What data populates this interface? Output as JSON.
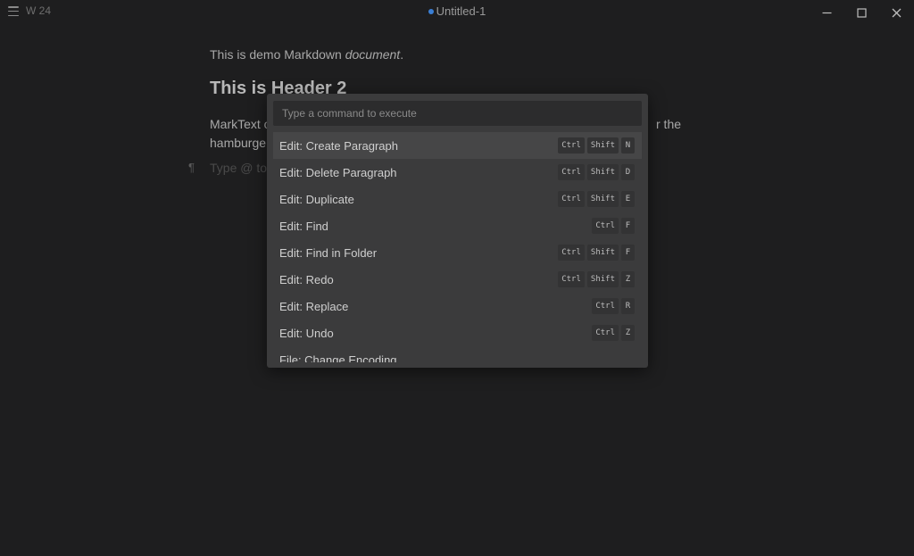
{
  "titlebar": {
    "word_count": "W 24",
    "title": "Untitled-1"
  },
  "document": {
    "p1_text": "This is demo Markdown ",
    "p1_em": "document",
    "p1_end": ".",
    "h2": "This is Header 2",
    "p2_line1": "MarkText o",
    "p2_tail": "r the",
    "p2_line2": "hamburge",
    "empty_placeholder": "Type @ to"
  },
  "palette": {
    "placeholder": "Type a command to execute",
    "items": [
      {
        "label": "Edit: Create Paragraph",
        "keys": [
          "Ctrl",
          "Shift",
          "N"
        ]
      },
      {
        "label": "Edit: Delete Paragraph",
        "keys": [
          "Ctrl",
          "Shift",
          "D"
        ]
      },
      {
        "label": "Edit: Duplicate",
        "keys": [
          "Ctrl",
          "Shift",
          "E"
        ]
      },
      {
        "label": "Edit: Find",
        "keys": [
          "Ctrl",
          "F"
        ]
      },
      {
        "label": "Edit: Find in Folder",
        "keys": [
          "Ctrl",
          "Shift",
          "F"
        ]
      },
      {
        "label": "Edit: Redo",
        "keys": [
          "Ctrl",
          "Shift",
          "Z"
        ]
      },
      {
        "label": "Edit: Replace",
        "keys": [
          "Ctrl",
          "R"
        ]
      },
      {
        "label": "Edit: Undo",
        "keys": [
          "Ctrl",
          "Z"
        ]
      },
      {
        "label": "File: Change Encoding",
        "keys": []
      }
    ]
  },
  "icons": {
    "menu": "hamburger-icon",
    "minimize": "minimize-icon",
    "maximize": "maximize-icon",
    "close": "close-icon",
    "pilcrow": "paragraph-icon"
  },
  "colors": {
    "background": "#1e1e1f",
    "palette_bg": "#3b3b3c",
    "accent_dot": "#3a7fd5"
  }
}
